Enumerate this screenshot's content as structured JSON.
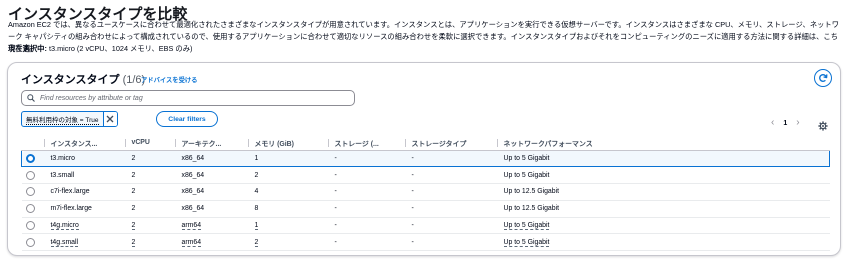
{
  "page": {
    "title": "インスタンスタイプを比較",
    "description": "Amazon EC2 では、異なるユースケースに合わせて最適化されたさまざまなインスタンスタイプが用意されています。インスタンスとは、アプリケーションを実行できる仮想サーバーです。インスタンスはさまざまな CPU、メモリ、ストレージ、ネットワーク キャパシティの組み合わせによって構成されているので、使用するアプリケーションに合わせて適切なリソースの組み合わせを柔軟に選択できます。インスタンスタイプおよびそれをコンピューティングのニーズに適用する方法に関する詳細は、こちらです。",
    "current_label": "現在選択中:",
    "current_value": "t3.micro (2 vCPU、1024 メモリ、EBS のみ)"
  },
  "panel": {
    "title": "インスタンスタイプ",
    "count": "(1/6)",
    "advice_link": "アドバイスを受ける"
  },
  "search": {
    "placeholder": "Find resources by attribute or tag"
  },
  "filter": {
    "token": "無料利用枠の対象 = True",
    "clear_label": "Clear filters"
  },
  "pagination": {
    "page": "1"
  },
  "table": {
    "columns": [
      "インスタンス...",
      "vCPU",
      "アーキテク...",
      "メモリ (GiB)",
      "ストレージ (...",
      "ストレージタイプ",
      "ネットワークパフォーマンス"
    ],
    "rows": [
      {
        "selected": true,
        "name": "t3.micro",
        "vcpu": "2",
        "arch": "x86_64",
        "mem": "1",
        "storage": "-",
        "storage_type": "-",
        "network": "Up to 5 Gigabit"
      },
      {
        "selected": false,
        "name": "t3.small",
        "vcpu": "2",
        "arch": "x86_64",
        "mem": "2",
        "storage": "-",
        "storage_type": "-",
        "network": "Up to 5 Gigabit"
      },
      {
        "selected": false,
        "name": "c7i-flex.large",
        "vcpu": "2",
        "arch": "x86_64",
        "mem": "4",
        "storage": "-",
        "storage_type": "-",
        "network": "Up to 12.5 Gigabit"
      },
      {
        "selected": false,
        "name": "m7i-flex.large",
        "vcpu": "2",
        "arch": "x86_64",
        "mem": "8",
        "storage": "-",
        "storage_type": "-",
        "network": "Up to 12.5 Gigabit"
      },
      {
        "selected": false,
        "name": "t4g.micro",
        "vcpu": "2",
        "arch": "arm64",
        "mem": "1",
        "storage": "-",
        "storage_type": "-",
        "network": "Up to 5 Gigabit"
      },
      {
        "selected": false,
        "name": "t4g.small",
        "vcpu": "2",
        "arch": "arm64",
        "mem": "2",
        "storage": "-",
        "storage_type": "-",
        "network": "Up to 5 Gigabit"
      }
    ]
  },
  "colors": {
    "accent": "#0972d3",
    "text": "#000716",
    "border": "#c6c6cd"
  }
}
